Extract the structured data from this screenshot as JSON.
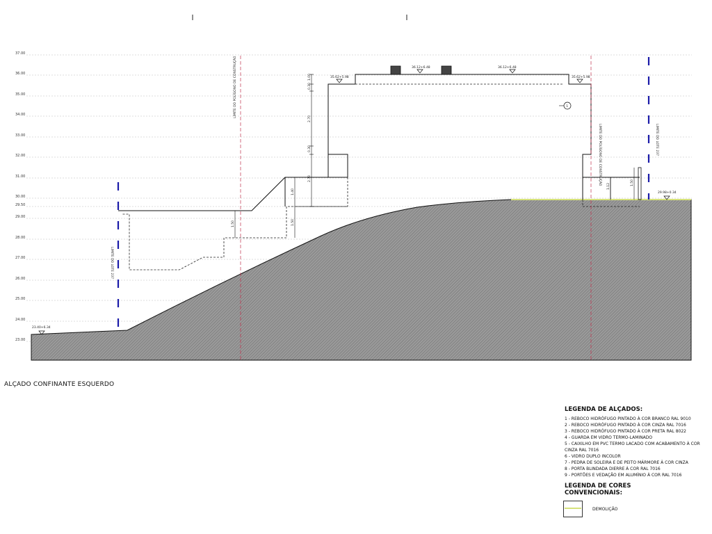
{
  "drawing_title": "ALÇADO CONFINANTE ESQUERDO",
  "levels": [
    "37.00",
    "36.00",
    "35.00",
    "34.00",
    "33.00",
    "32.00",
    "31.00",
    "30.00",
    "29.50",
    "29.00",
    "28.00",
    "27.00",
    "26.00",
    "25.00",
    "24.00",
    "23.00"
  ],
  "spot_levels": {
    "left_ground": "23.40+6.34",
    "roof_left": "35.62+5.98",
    "roof_mid_left": "36.12+6.48",
    "roof_mid_right": "36.12+6.48",
    "roof_right": "35.62+5.98",
    "right_ground": "29.98+0.34"
  },
  "dimensions": {
    "parapet": "1.00",
    "slab": "0.30",
    "upper_floor": "2.70",
    "lower_slab": "0.30",
    "ground_floor": "2.70",
    "step": "1.40",
    "basement_1": "1.50",
    "basement_2": "1.50",
    "right_wall": "1.12",
    "right_guard": "1.50"
  },
  "vertical_labels": {
    "limit_polygon_left": "LIMITE DO POLÍGONO DE CONSTRUÇÃO",
    "limit_polygon_right": "LIMITE DO POLÍGONO DE CONSTRUÇÃO",
    "plot_limit_left": "LIMITE DO LOTE 237",
    "plot_limit_right": "LIMITE DO LOTE 237"
  },
  "callout": "1",
  "legend": {
    "title": "LEGENDA DE ALÇADOS:",
    "items": [
      "1 - REBOCO HIDRÓFUGO PINTADO À COR BRANCO RAL 9010",
      "2 - REBOCO HIDRÓFUGO PINTADO À COR CINZA RAL 7016",
      "3 - REBOCO HIDRÓFUGO PINTADO À COR PRETA RAL 8022",
      "4 - GUARDA EM VIDRO TERMO-LAMINADO",
      "5 - CAIXILHO EM PVC TERMO LACADO COM ACABAMENTO À COR CINZA RAL 7016",
      "6 - VIDRO DUPLO INCOLOR",
      "7 - PEDRA DE SOLEIRA E DE PEITO MÁRMORE À COR CINZA",
      "8 - PORTA BLINDADA DIERRE À COR RAL 7016",
      "9 - PORTÕES E VEDAÇÃO EM ALUMÍNIO À COR RAL 7016"
    ],
    "colors_title": "LEGENDA DE CORES CONVENCIONAIS:",
    "demolition_label": "DEMOLIÇÃO",
    "demolition_color": "#d6e27a"
  },
  "colors": {
    "ground_fill": "#8a8a8a",
    "limit_line": "#c0304a",
    "plot_limit": "#1a1aa8"
  }
}
